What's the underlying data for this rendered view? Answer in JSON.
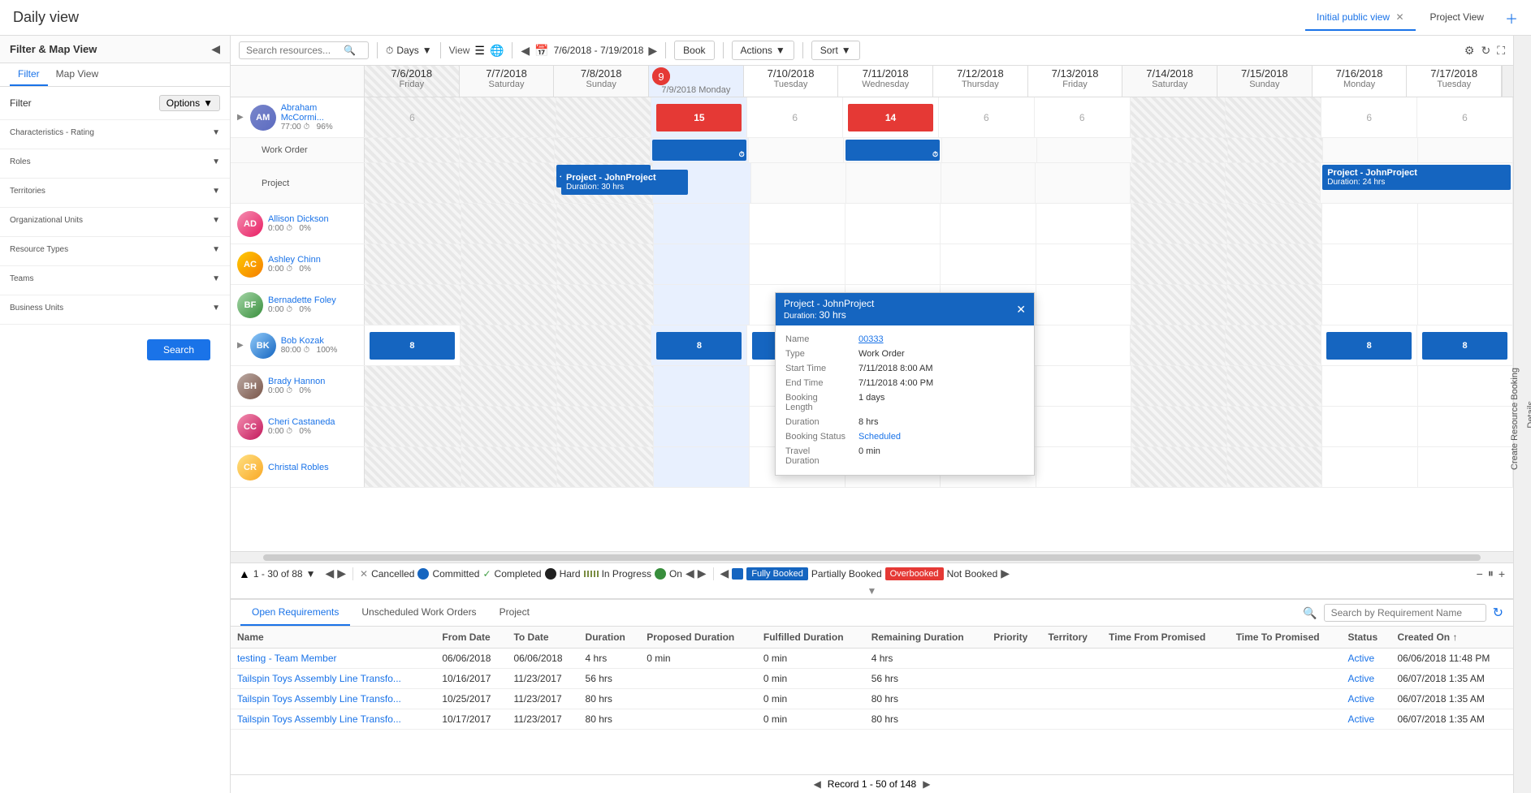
{
  "app": {
    "title": "Daily view",
    "tabs": [
      {
        "label": "Initial public view",
        "active": true
      },
      {
        "label": "Project View",
        "active": false
      }
    ]
  },
  "toolbar": {
    "search_placeholder": "Search resources...",
    "days_label": "Days",
    "view_label": "View",
    "date_range": "7/6/2018 - 7/19/2018",
    "book_label": "Book",
    "actions_label": "Actions",
    "sort_label": "Sort"
  },
  "filter": {
    "title": "Filter & Map View",
    "filter_tab": "Filter",
    "map_tab": "Map View",
    "options_label": "Options",
    "sections": [
      {
        "label": "Characteristics - Rating"
      },
      {
        "label": "Roles"
      },
      {
        "label": "Territories"
      },
      {
        "label": "Organizational Units"
      },
      {
        "label": "Resource Types"
      },
      {
        "label": "Teams"
      },
      {
        "label": "Business Units"
      }
    ],
    "search_label": "Search"
  },
  "calendar": {
    "dates": [
      {
        "date": "7/6/2018",
        "day": "Friday",
        "num": "6",
        "weekend": false
      },
      {
        "date": "7/7/2018",
        "day": "Saturday",
        "num": "7",
        "weekend": true
      },
      {
        "date": "7/8/2018",
        "day": "Sunday",
        "num": "8",
        "weekend": true
      },
      {
        "date": "7/9/2018",
        "day": "Monday",
        "num": "9",
        "weekend": false,
        "today": true
      },
      {
        "date": "7/10/2018",
        "day": "Tuesday",
        "num": "10",
        "weekend": false
      },
      {
        "date": "7/11/2018",
        "day": "Wednesday",
        "num": "11",
        "weekend": false
      },
      {
        "date": "7/12/2018",
        "day": "Thursday",
        "num": "12",
        "weekend": false
      },
      {
        "date": "7/13/2018",
        "day": "Friday",
        "num": "13",
        "weekend": false
      },
      {
        "date": "7/14/2018",
        "day": "Saturday",
        "num": "14",
        "weekend": true
      },
      {
        "date": "7/15/2018",
        "day": "Sunday",
        "num": "15",
        "weekend": true
      },
      {
        "date": "7/16/2018",
        "day": "Monday",
        "num": "16",
        "weekend": false
      },
      {
        "date": "7/17/2018",
        "day": "Tuesday",
        "num": "17",
        "weekend": false
      }
    ]
  },
  "resources": [
    {
      "name": "Abraham McCormi...",
      "hours": "77:00",
      "pct": "96%",
      "avatar_class": "avatar-am",
      "initials": "AM"
    },
    {
      "name": "Allison Dickson",
      "hours": "0:00",
      "pct": "0%",
      "avatar_class": "avatar-ad",
      "initials": "AD"
    },
    {
      "name": "Ashley Chinn",
      "hours": "0:00",
      "pct": "0%",
      "avatar_class": "avatar-ac",
      "initials": "AC"
    },
    {
      "name": "Bernadette Foley",
      "hours": "0:00",
      "pct": "0%",
      "avatar_class": "avatar-bf",
      "initials": "BF"
    },
    {
      "name": "Bob Kozak",
      "hours": "80:00",
      "pct": "100%",
      "avatar_class": "avatar-bk",
      "initials": "BK"
    },
    {
      "name": "Brady Hannon",
      "hours": "0:00",
      "pct": "0%",
      "avatar_class": "avatar-bh",
      "initials": "BH"
    },
    {
      "name": "Cheri Castaneda",
      "hours": "0:00",
      "pct": "0%",
      "avatar_class": "avatar-cc",
      "initials": "CC"
    },
    {
      "name": "Christal Robles",
      "avatar_class": "avatar-cr",
      "initials": "CR"
    }
  ],
  "popup": {
    "title": "Project - JohnProject",
    "duration": "30 hrs",
    "name_label": "Name",
    "name_value": "00333",
    "type_label": "Type",
    "type_value": "Work Order",
    "start_label": "Start Time",
    "start_value": "7/11/2018 8:00 AM",
    "end_label": "End Time",
    "end_value": "7/11/2018 4:00 PM",
    "booking_length_label": "Booking Length",
    "booking_length_value": "1 days",
    "duration_label": "Duration",
    "duration_value": "8 hrs",
    "booking_status_label": "Booking Status",
    "booking_status_value": "Scheduled",
    "travel_label": "Travel Duration",
    "travel_value": "0 min"
  },
  "pager": {
    "current": "1 - 30 of 88",
    "legend": [
      {
        "label": "Cancelled",
        "color": "#9e9e9e",
        "icon": "x"
      },
      {
        "label": "Committed",
        "color": "#1565c0",
        "icon": "dot"
      },
      {
        "label": "Completed",
        "color": "#43a047",
        "icon": "check"
      },
      {
        "label": "Hard",
        "color": "#212121",
        "icon": "dot"
      },
      {
        "label": "In Progress",
        "color": "#7b8d42",
        "icon": "dots"
      },
      {
        "label": "On",
        "color": "#388e3c",
        "icon": "dot"
      }
    ],
    "legend2": [
      {
        "label": "Fully Booked",
        "color": "#1565c0"
      },
      {
        "label": "Partially Booked",
        "color": "#7b8d42"
      },
      {
        "label": "Overbooked",
        "color": "#e53935"
      },
      {
        "label": "Not Booked",
        "color": "#9e9e9e"
      }
    ]
  },
  "lower": {
    "tabs": [
      {
        "label": "Open Requirements",
        "active": true
      },
      {
        "label": "Unscheduled Work Orders",
        "active": false
      },
      {
        "label": "Project",
        "active": false
      }
    ],
    "search_placeholder": "Search by Requirement Name",
    "columns": [
      "Name",
      "From Date",
      "To Date",
      "Duration",
      "Proposed Duration",
      "Fulfilled Duration",
      "Remaining Duration",
      "Priority",
      "Territory",
      "Time From Promised",
      "Time To Promised",
      "Status",
      "Created On"
    ],
    "rows": [
      {
        "name": "testing - Team Member",
        "from": "06/06/2018",
        "to": "06/06/2018",
        "duration": "4 hrs",
        "proposed": "0 min",
        "fulfilled": "0 min",
        "remaining": "4 hrs",
        "priority": "",
        "territory": "",
        "time_from": "",
        "time_to": "",
        "status": "Active",
        "created": "06/06/2018 11:48 PM"
      },
      {
        "name": "Tailspin Toys Assembly Line Transfo...",
        "from": "10/16/2017",
        "to": "11/23/2017",
        "duration": "56 hrs",
        "proposed": "",
        "fulfilled": "0 min",
        "remaining": "56 hrs",
        "priority": "",
        "territory": "",
        "time_from": "",
        "time_to": "",
        "status": "Active",
        "created": "06/07/2018 1:35 AM"
      },
      {
        "name": "Tailspin Toys Assembly Line Transfo...",
        "from": "10/25/2017",
        "to": "11/23/2017",
        "duration": "80 hrs",
        "proposed": "",
        "fulfilled": "0 min",
        "remaining": "80 hrs",
        "priority": "",
        "territory": "",
        "time_from": "",
        "time_to": "",
        "status": "Active",
        "created": "06/07/2018 1:35 AM"
      },
      {
        "name": "Tailspin Toys Assembly Line Transfo...",
        "from": "10/17/2017",
        "to": "11/23/2017",
        "duration": "80 hrs",
        "proposed": "",
        "fulfilled": "0 min",
        "remaining": "80 hrs",
        "priority": "",
        "territory": "",
        "time_from": "",
        "time_to": "",
        "status": "Active",
        "created": "06/07/2018 1:35 AM"
      }
    ],
    "pager": "Record 1 - 50 of 148"
  }
}
